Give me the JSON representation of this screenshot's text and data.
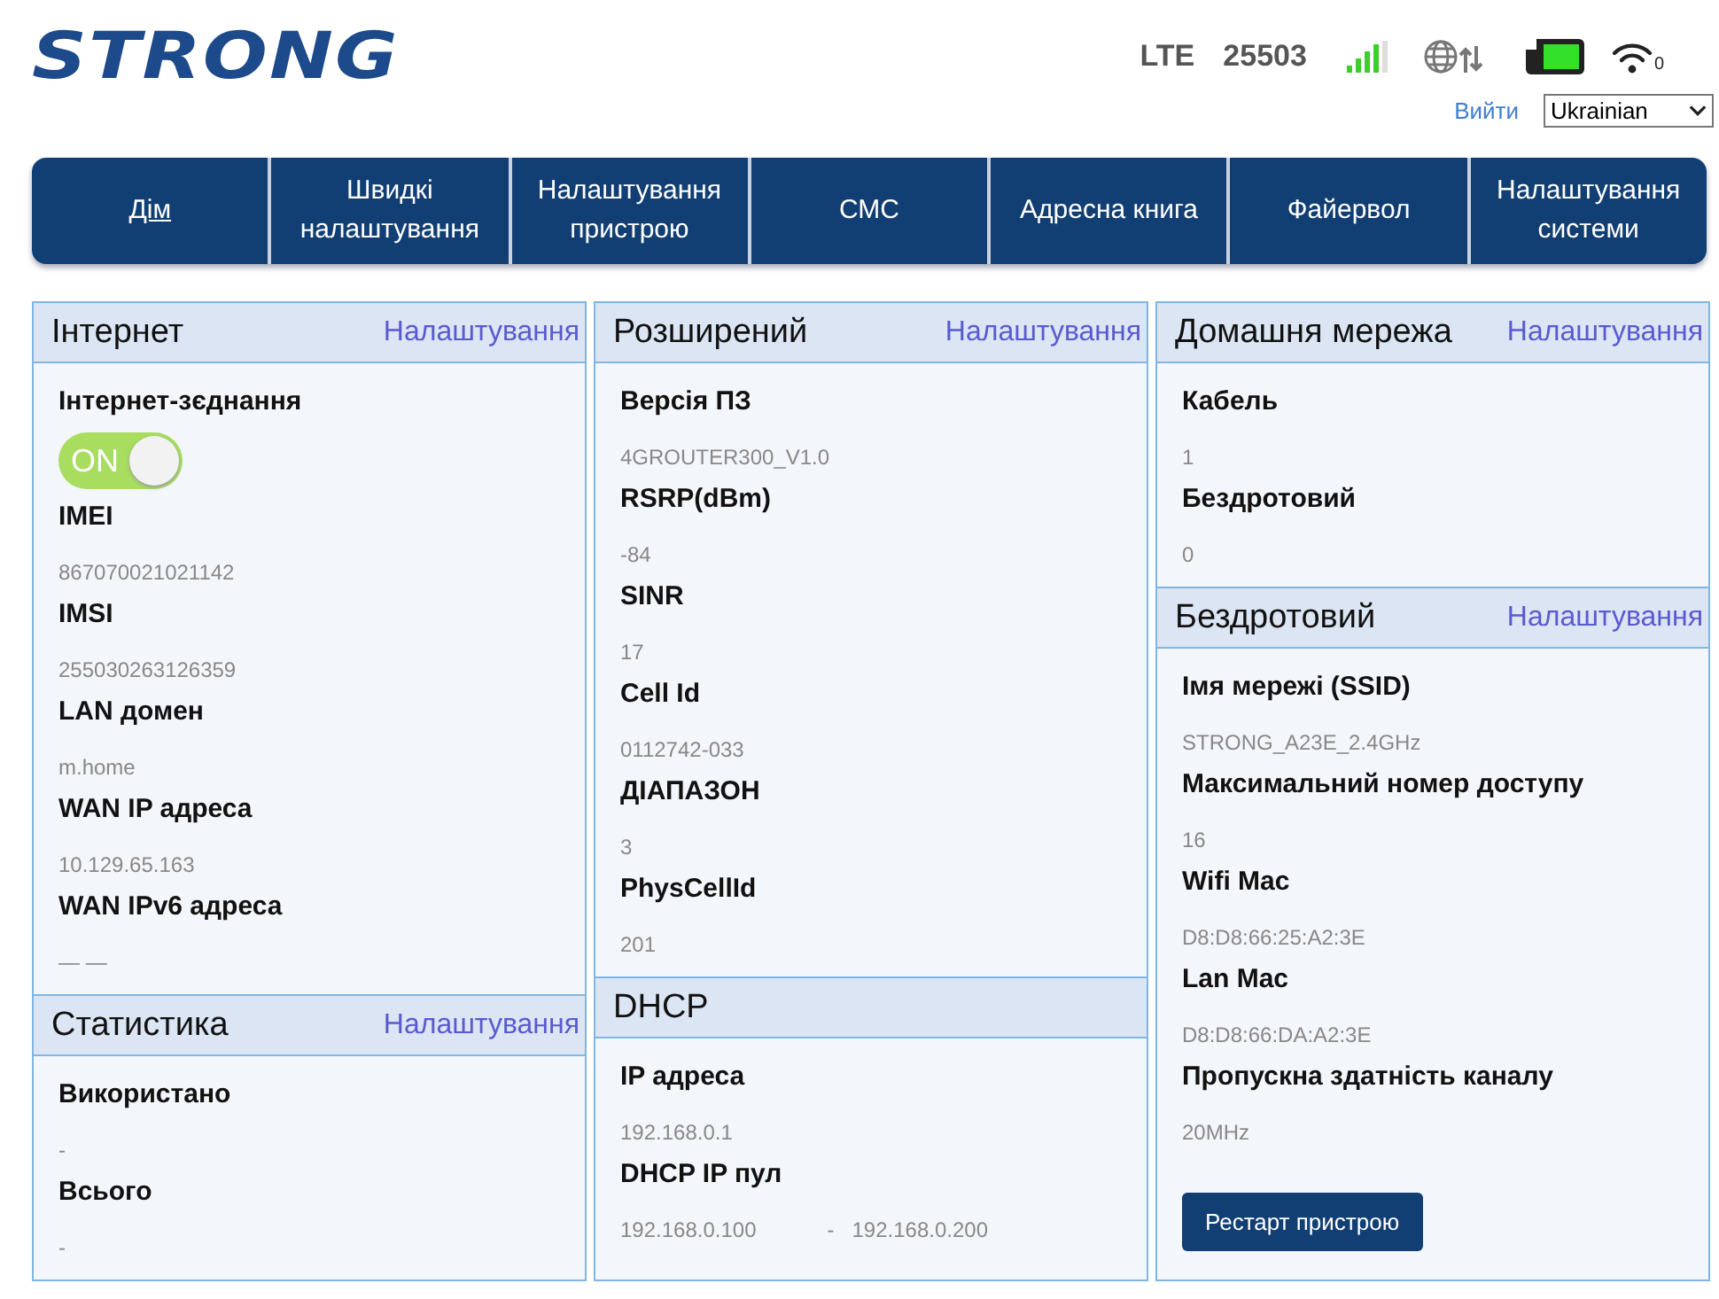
{
  "header": {
    "logo": "STRONG",
    "network": "LTE",
    "operator": "25503",
    "wifi_clients": "0",
    "logout": "Вийти",
    "language": "Ukrainian"
  },
  "nav": [
    {
      "label": "Дім",
      "selected": true
    },
    {
      "label": "Швидкі налаштування",
      "selected": false
    },
    {
      "label": "Налаштування пристрою",
      "selected": false
    },
    {
      "label": "СМС",
      "selected": false
    },
    {
      "label": "Адресна книга",
      "selected": false
    },
    {
      "label": "Файервол",
      "selected": false
    },
    {
      "label": "Налаштування системи",
      "selected": false
    }
  ],
  "columns": [
    {
      "panels": [
        {
          "title": "Інтернет",
          "link": "Налаштування",
          "fields": [
            {
              "kind": "toggle",
              "label": "Інтернет-зєднання",
              "text": "ON",
              "on": true
            },
            {
              "kind": "text",
              "label": "IMEI",
              "value": "867070021021142"
            },
            {
              "kind": "text",
              "label": "IMSI",
              "value": "255030263126359"
            },
            {
              "kind": "text",
              "label": "LAN домен",
              "value": "m.home"
            },
            {
              "kind": "text",
              "label": "WAN IP адреса",
              "value": "10.129.65.163"
            },
            {
              "kind": "text",
              "label": "WAN IPv6 адреса",
              "value": "— —"
            }
          ]
        },
        {
          "title": "Статистика",
          "link": "Налаштування",
          "fields": [
            {
              "kind": "text",
              "label": "Використано",
              "value": "-"
            },
            {
              "kind": "text",
              "label": "Всього",
              "value": "-"
            }
          ]
        }
      ]
    },
    {
      "panels": [
        {
          "title": "Розширений",
          "link": "Налаштування",
          "fields": [
            {
              "kind": "text",
              "label": "Версія ПЗ",
              "value": "4GROUTER300_V1.0"
            },
            {
              "kind": "text",
              "label": "RSRP(dBm)",
              "value": "-84"
            },
            {
              "kind": "text",
              "label": "SINR",
              "value": "17"
            },
            {
              "kind": "text",
              "label": "Cell Id",
              "value": "0112742-033"
            },
            {
              "kind": "text",
              "label": "ДІАПАЗОН",
              "value": "3"
            },
            {
              "kind": "text",
              "label": "PhysCellId",
              "value": "201"
            }
          ]
        },
        {
          "title": "DHCP",
          "fields": [
            {
              "kind": "text",
              "label": "IP адреса",
              "value": "192.168.0.1"
            },
            {
              "kind": "range",
              "label": "DHCP IP пул",
              "from": "192.168.0.100",
              "separator": "-",
              "to": "192.168.0.200"
            }
          ]
        }
      ]
    },
    {
      "panels": [
        {
          "title": "Домашня мережа",
          "link": "Налаштування",
          "fields": [
            {
              "kind": "text",
              "label": "Кабель",
              "value": "1"
            },
            {
              "kind": "text",
              "label": "Бездротовий",
              "value": "0"
            }
          ]
        },
        {
          "title": "Бездротовий",
          "link": "Налаштування",
          "fields": [
            {
              "kind": "text",
              "label": "Імя мережі (SSID)",
              "value": "STRONG_A23E_2.4GHz"
            },
            {
              "kind": "text",
              "label": "Максимальний номер доступу",
              "value": "16"
            },
            {
              "kind": "text",
              "label": "Wifi Mac",
              "value": "D8:D8:66:25:A2:3E"
            },
            {
              "kind": "text",
              "label": "Lan Mac",
              "value": "D8:D8:66:DA:A2:3E"
            },
            {
              "kind": "text",
              "label": "Пропускна здатність каналу",
              "value": "20MHz"
            }
          ],
          "button": "Рестарт пристрою"
        }
      ]
    }
  ]
}
